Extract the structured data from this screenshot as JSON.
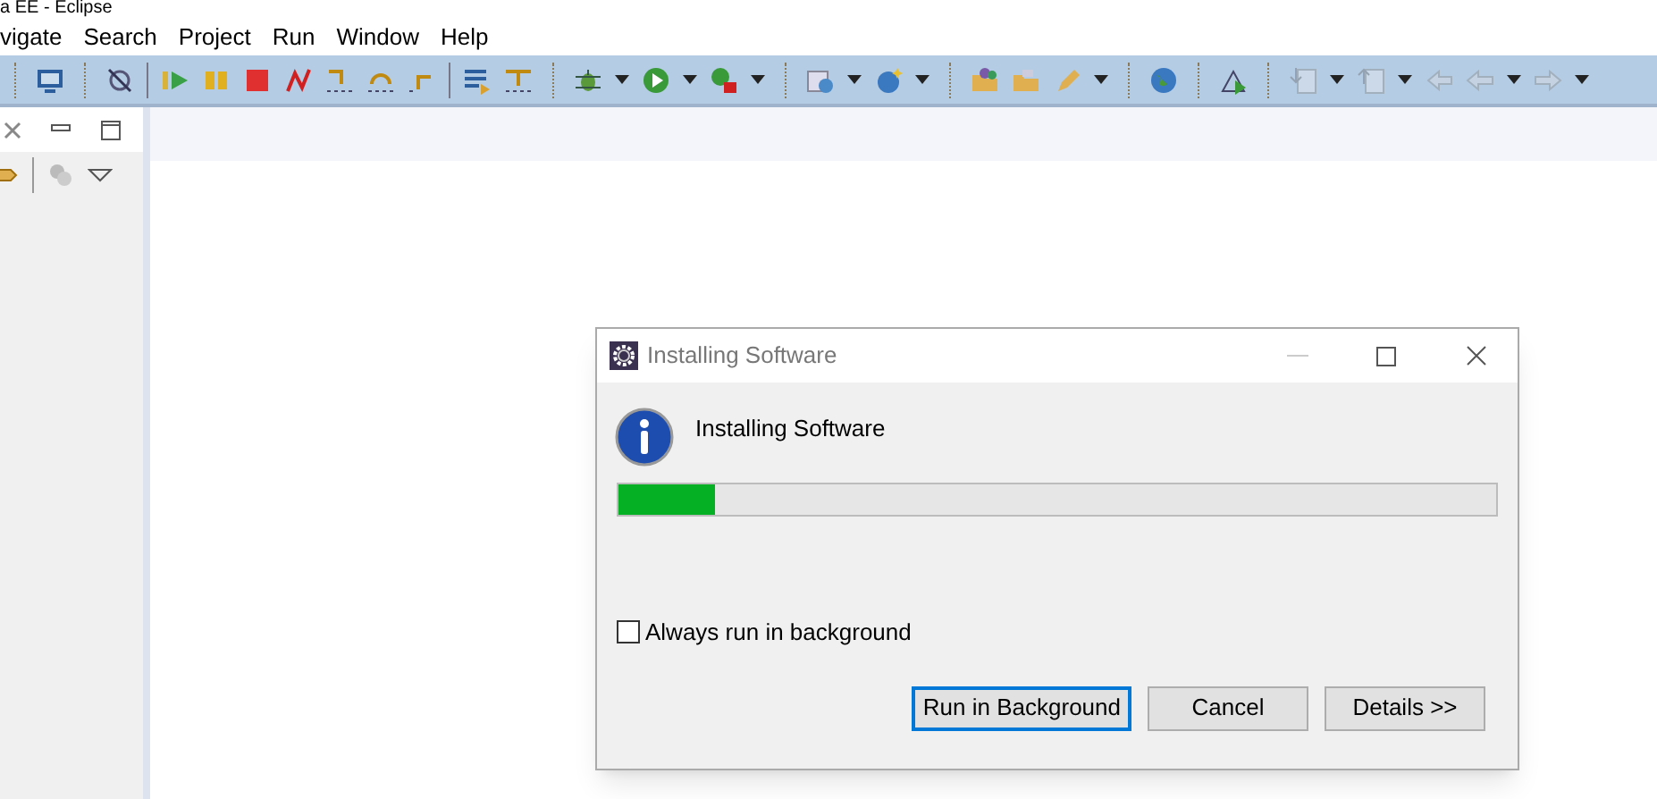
{
  "window": {
    "title": "a EE - Eclipse"
  },
  "menu": [
    {
      "label": "vigate"
    },
    {
      "label": "Search"
    },
    {
      "label": "Project"
    },
    {
      "label": "Run"
    },
    {
      "label": "Window"
    },
    {
      "label": "Help"
    }
  ],
  "dialog": {
    "title": "Installing Software",
    "message": "Installing Software",
    "progress": {
      "level": 0.11
    },
    "checkbox": {
      "label": "Always run in background",
      "checked": false
    },
    "buttons": [
      {
        "label": "Run in Background",
        "selected": true
      },
      {
        "label": "Cancel",
        "selected": false
      },
      {
        "label": "Details >>",
        "selected": false
      }
    ]
  }
}
